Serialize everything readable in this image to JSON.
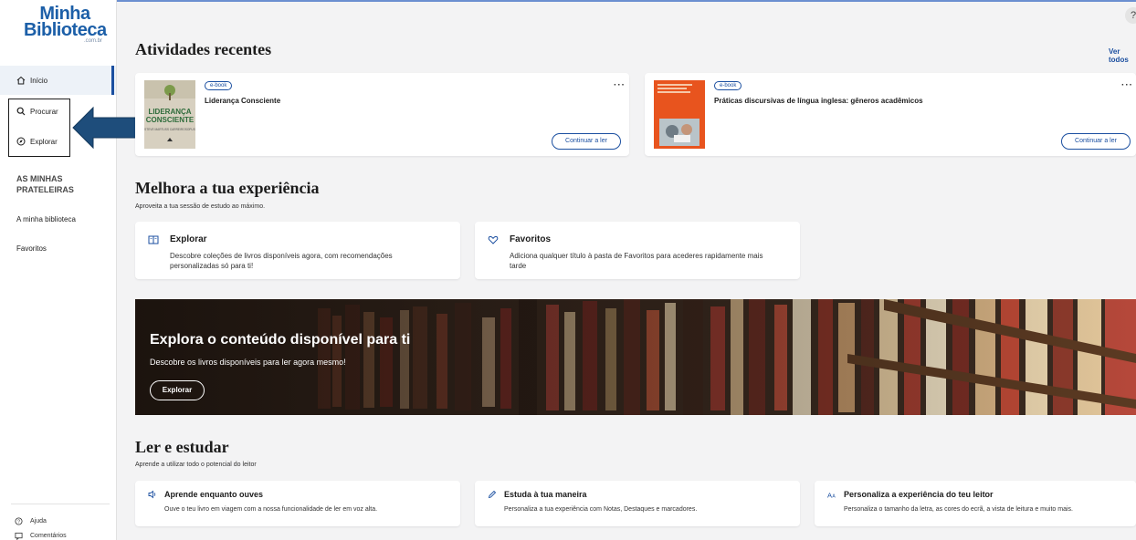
{
  "logo": {
    "line1": "Minha",
    "line2": "Biblioteca",
    "line3": ".com.br"
  },
  "sidebar": {
    "nav": [
      {
        "label": "Início",
        "icon": "home-icon"
      },
      {
        "label": "Procurar",
        "icon": "search-icon"
      },
      {
        "label": "Explorar",
        "icon": "compass-icon"
      }
    ],
    "shelves_heading_line1": "AS MINHAS",
    "shelves_heading_line2": "PRATELEIRAS",
    "links": [
      "A minha biblioteca",
      "Favoritos"
    ],
    "footer": [
      {
        "label": "Ajuda",
        "icon": "help-icon"
      },
      {
        "label": "Comentários",
        "icon": "comment-icon"
      }
    ]
  },
  "recent": {
    "title": "Atividades recentes",
    "see_all": "Ver todos",
    "items": [
      {
        "badge": "e-book",
        "title": "Liderança Consciente",
        "cover_line1": "LIDERANÇA",
        "cover_line2": "CONSCIENTE",
        "cover_author": "STEVE MARTUSS CARREIROSOPUS",
        "action": "Continuar a ler"
      },
      {
        "badge": "e-book",
        "title": "Práticas discursivas de língua inglesa: gêneros acadêmicos",
        "action": "Continuar a ler"
      }
    ]
  },
  "improve": {
    "title": "Melhora a tua experiência",
    "subtitle": "Aproveita a tua sessão de estudo ao máximo.",
    "cards": [
      {
        "title": "Explorar",
        "desc1": "Descobre coleções de livros disponíveis agora, com recomendações",
        "desc2": "personalizadas só para ti!"
      },
      {
        "title": "Favoritos",
        "desc1": "Adiciona qualquer título à pasta de Favoritos para acederes rapidamente mais",
        "desc2": "tarde"
      }
    ]
  },
  "banner": {
    "title": "Explora o conteúdo disponível para ti",
    "subtitle": "Descobre os livros disponíveis para ler agora mesmo!",
    "button": "Explorar"
  },
  "study": {
    "title": "Ler e estudar",
    "subtitle": "Aprende a utilizar todo o potencial do leitor",
    "cards": [
      {
        "title": "Aprende enquanto ouves",
        "desc": "Ouve o teu livro em viagem com a nossa funcionalidade de ler em voz alta.",
        "icon": "speaker-icon"
      },
      {
        "title": "Estuda à tua maneira",
        "desc": "Personaliza a tua experiência com Notas, Destaques e marcadores.",
        "icon": "pencil-icon"
      },
      {
        "title": "Personaliza a experiência do teu leitor",
        "desc": "Personaliza o tamanho da letra, as cores do ecrã, a vista de leitura e muito mais.",
        "icon": "font-size-icon"
      }
    ]
  },
  "colors": {
    "accent": "#1b4fa0",
    "logo": "#1c5fa8",
    "arrow": "#1e4d7b"
  }
}
